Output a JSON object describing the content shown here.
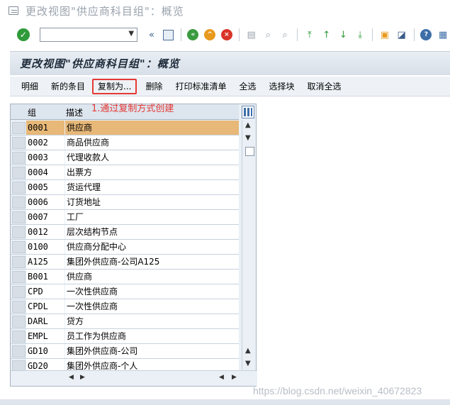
{
  "window": {
    "title": "更改视图\"供应商科目组\"：概览"
  },
  "toolbar": {
    "command_value": "",
    "icons": [
      "enter-icon",
      "back-icon",
      "save-icon",
      "back-arrow-icon",
      "exit-icon",
      "cancel-icon",
      "print-icon",
      "find-icon",
      "find-next-icon",
      "first-page-icon",
      "prev-page-icon",
      "next-page-icon",
      "last-page-icon",
      "new-session-icon",
      "shortcut-icon",
      "help-icon",
      "customize-icon"
    ]
  },
  "screen": {
    "title": "更改视图\"供应商科目组\"：概览"
  },
  "app_toolbar": {
    "details": "明细",
    "new_entries": "新的条目",
    "copy_as": "复制为...",
    "delete": "删除",
    "print_std_list": "打印标准清单",
    "select_all": "全选",
    "select_block": "选择块",
    "deselect_all": "取消全选"
  },
  "annotation": "1.通过复制方式创建",
  "table": {
    "columns": [
      "组",
      "描述"
    ],
    "rows": [
      [
        "0001",
        "供应商"
      ],
      [
        "0002",
        "商品供应商"
      ],
      [
        "0003",
        "代理收款人"
      ],
      [
        "0004",
        "出票方"
      ],
      [
        "0005",
        "货运代理"
      ],
      [
        "0006",
        "订货地址"
      ],
      [
        "0007",
        "工厂"
      ],
      [
        "0012",
        "层次结构节点"
      ],
      [
        "0100",
        "供应商分配中心"
      ],
      [
        "A125",
        "集团外供应商-公司A125"
      ],
      [
        "B001",
        "供应商"
      ],
      [
        "CPD",
        "一次性供应商"
      ],
      [
        "CPDL",
        "一次性供应商"
      ],
      [
        "DARL",
        "贷方"
      ],
      [
        "EMPL",
        "员工作为供应商"
      ],
      [
        "GD10",
        "集团外供应商-公司"
      ],
      [
        "GD20",
        "集团外供应商-个人"
      ]
    ]
  },
  "watermark": "https://blog.csdn.net/weixin_40672823",
  "colors": {
    "selected_row": "#e7b878",
    "highlight_box": "#e53935"
  }
}
